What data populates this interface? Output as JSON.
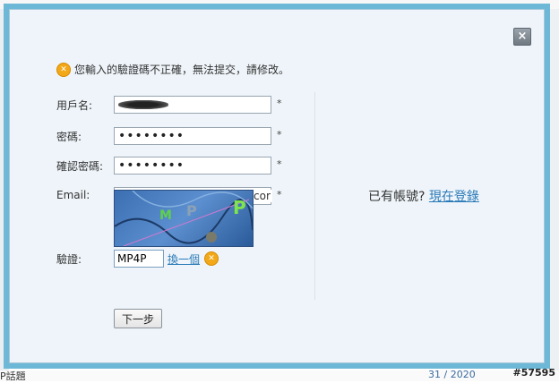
{
  "background": {
    "bottom_text": "P話題",
    "bottom_count": "31 / 2020",
    "watermark": "#57595"
  },
  "modal": {
    "close_label": "×",
    "error_message": "您輸入的驗證碼不正確，無法提交，請修改。",
    "fields": {
      "username_label": "用戶名:",
      "password_label": "密碼:",
      "password_value": "••••••••",
      "confirm_label": "確認密碼:",
      "confirm_value": "••••••••",
      "email_label": "Email:",
      "email_suffix": "cor",
      "verify_label": "驗證:",
      "verify_value": "MP4P",
      "required_mark": "*"
    },
    "captcha": {
      "chars": [
        "M",
        "P",
        "P"
      ]
    },
    "change_link": "換一個",
    "login_prompt": "已有帳號?",
    "login_link": "現在登錄",
    "next_button": "下一步"
  },
  "colors": {
    "modal_border": "#6cb8d6",
    "link": "#2a7ab8",
    "error_icon": "#f2a818"
  }
}
